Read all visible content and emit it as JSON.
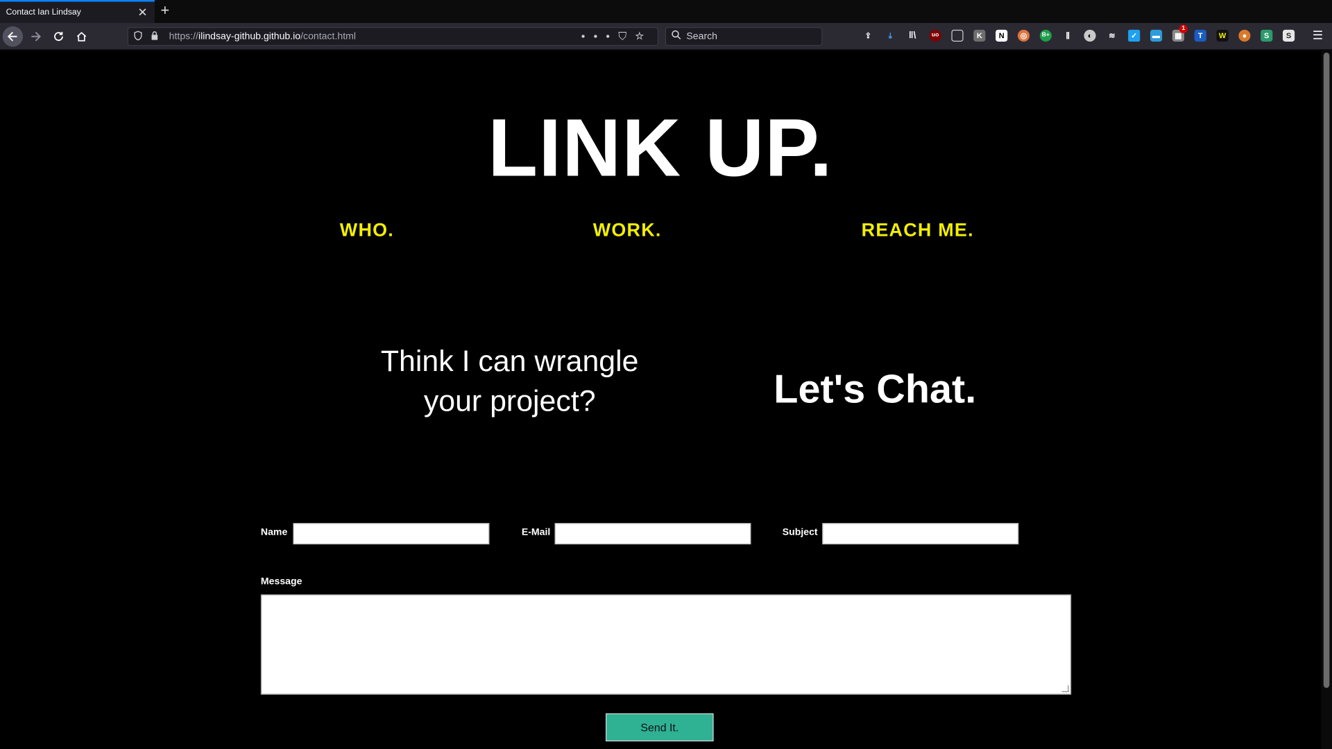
{
  "browser": {
    "tab_title": "Contact Ian Lindsay",
    "tab_close": "✕",
    "new_tab": "+",
    "url_scheme": "https://",
    "url_host": "ilindsay-github.github.io",
    "url_path": "/contact.html",
    "search_placeholder": "Search",
    "accent": "#0a84ff"
  },
  "hero": {
    "title": "LINK UP."
  },
  "nav": {
    "who": "WHO.",
    "work": "WORK.",
    "reach": "REACH ME.",
    "color": "#f3ef00"
  },
  "pitch": {
    "line1": "Think I can wrangle",
    "line2": "your project?",
    "cta": "Let's Chat."
  },
  "form": {
    "name_label": "Name",
    "email_label": "E-Mail",
    "subject_label": "Subject",
    "message_label": "Message",
    "submit_label": "Send It.",
    "submit_color": "#2fb193"
  },
  "extensions": {
    "badge_count": "1"
  }
}
